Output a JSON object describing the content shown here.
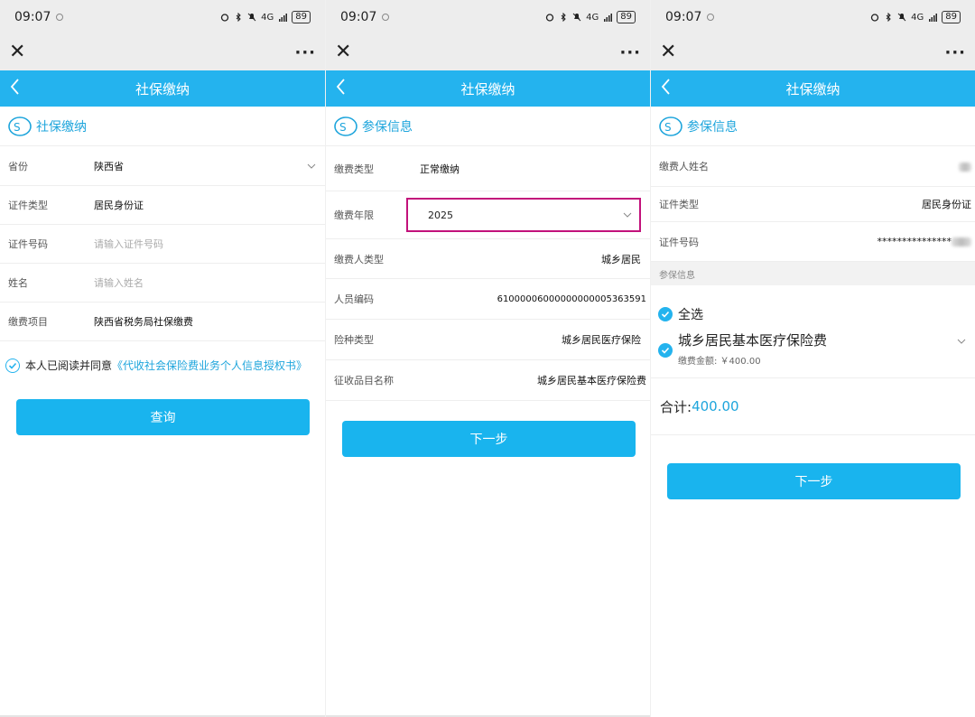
{
  "status": {
    "time": "09:07",
    "battery": "89",
    "network": "4G"
  },
  "screens": [
    {
      "title": "社保缴纳",
      "section": "社保缴纳",
      "rows": [
        {
          "label": "省份",
          "value": "陕西省"
        },
        {
          "label": "证件类型",
          "value": "居民身份证"
        },
        {
          "label": "证件号码",
          "placeholder": "请输入证件号码"
        },
        {
          "label": "姓名",
          "placeholder": "请输入姓名"
        },
        {
          "label": "缴费项目",
          "value": "陕西省税务局社保缴费"
        }
      ],
      "agree_text": "本人已阅读并同意",
      "agree_link": "《代收社会保险费业务个人信息授权书》",
      "button": "查询"
    },
    {
      "title": "社保缴纳",
      "section": "参保信息",
      "rows": [
        {
          "label": "缴费类型",
          "value": "正常缴纳"
        },
        {
          "label": "缴费年限",
          "value": "2025"
        },
        {
          "label": "缴费人类型",
          "value": "城乡居民"
        },
        {
          "label": "人员编码",
          "value": "61000006000000000005363591"
        },
        {
          "label": "险种类型",
          "value": "城乡居民医疗保险"
        },
        {
          "label": "征收品目名称",
          "value": "城乡居民基本医疗保险费"
        }
      ],
      "button": "下一步"
    },
    {
      "title": "社保缴纳",
      "section": "参保信息",
      "rows": [
        {
          "label": "缴费人姓名",
          "value": ""
        },
        {
          "label": "证件类型",
          "value": "居民身份证"
        },
        {
          "label": "证件号码",
          "value": "***************"
        }
      ],
      "sub_header": "参保信息",
      "select_all": "全选",
      "item_name": "城乡居民基本医疗保险费",
      "item_amount_label": "缴费金额:",
      "item_amount": "￥400.00",
      "total_label": "合计:",
      "total_value": "400.00",
      "button": "下一步"
    }
  ],
  "colors": {
    "accent": "#24b3ee",
    "highlight": "#c2127b"
  }
}
